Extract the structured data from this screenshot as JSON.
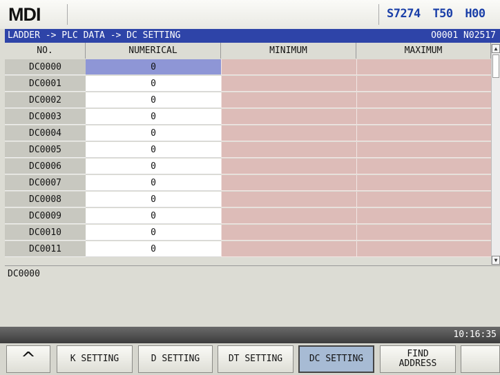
{
  "header": {
    "mode": "MDI",
    "spindle": "S7274",
    "tool": "T50",
    "offset": "H00"
  },
  "pathbar": {
    "path": "LADDER -> PLC DATA -> DC SETTING",
    "program": "O0001 N02517"
  },
  "table": {
    "columns": [
      "NO.",
      "NUMERICAL",
      "MINIMUM",
      "MAXIMUM"
    ],
    "rows": [
      {
        "no": "DC0000",
        "value": "0",
        "min": "",
        "max": ""
      },
      {
        "no": "DC0001",
        "value": "0",
        "min": "",
        "max": ""
      },
      {
        "no": "DC0002",
        "value": "0",
        "min": "",
        "max": ""
      },
      {
        "no": "DC0003",
        "value": "0",
        "min": "",
        "max": ""
      },
      {
        "no": "DC0004",
        "value": "0",
        "min": "",
        "max": ""
      },
      {
        "no": "DC0005",
        "value": "0",
        "min": "",
        "max": ""
      },
      {
        "no": "DC0006",
        "value": "0",
        "min": "",
        "max": ""
      },
      {
        "no": "DC0007",
        "value": "0",
        "min": "",
        "max": ""
      },
      {
        "no": "DC0008",
        "value": "0",
        "min": "",
        "max": ""
      },
      {
        "no": "DC0009",
        "value": "0",
        "min": "",
        "max": ""
      },
      {
        "no": "DC0010",
        "value": "0",
        "min": "",
        "max": ""
      },
      {
        "no": "DC0011",
        "value": "0",
        "min": "",
        "max": ""
      }
    ],
    "selected_row": 0
  },
  "info": {
    "current_address": "DC0000"
  },
  "status": {
    "time": "10:16:35"
  },
  "softkeys": {
    "up_icon": "chevron-up-icon",
    "k_setting": "K SETTING",
    "d_setting": "D SETTING",
    "dt_setting": "DT SETTING",
    "dc_setting": "DC SETTING",
    "find_address": "FIND ADDRESS"
  },
  "colors": {
    "accent": "#2e44a8",
    "selected": "#8e96d6",
    "range_cells": "#ddbcb8",
    "status_text": "#1a3fa8"
  }
}
